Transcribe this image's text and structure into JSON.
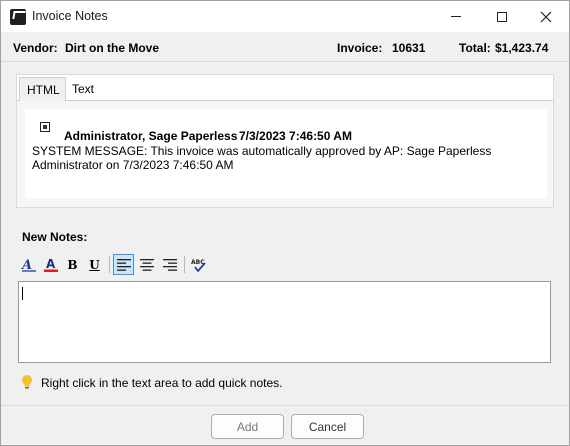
{
  "window": {
    "title": "Invoice Notes",
    "icon": "app-logo-icon"
  },
  "header": {
    "vendor_label": "Vendor:",
    "vendor_value": "Dirt on the Move",
    "invoice_label": "Invoice:",
    "invoice_value": "10631",
    "total_label": "Total:",
    "total_value": "$1,423.74"
  },
  "tabs": [
    {
      "label": "HTML",
      "selected": true
    },
    {
      "label": "Text",
      "selected": false
    }
  ],
  "notes": [
    {
      "author": "Administrator, Sage Paperless",
      "timestamp": "7/3/2023 7:46:50 AM",
      "body": "SYSTEM MESSAGE: This invoice was automatically approved by AP: Sage Paperless Administrator on 7/3/2023 7:46:50 AM"
    }
  ],
  "new_notes": {
    "label": "New Notes:",
    "toolbar": {
      "font_icon": "font-style-icon",
      "font_color_icon": "font-color-icon",
      "bold_label": "B",
      "underline_label": "U",
      "align_left_icon": "align-left-icon",
      "align_center_icon": "align-center-icon",
      "align_right_icon": "align-right-icon",
      "spellcheck_icon": "spellcheck-icon",
      "active_alignment": "left"
    },
    "editor_value": ""
  },
  "hint": {
    "icon": "lightbulb-icon",
    "text": "Right click in the text area to add quick notes."
  },
  "buttons": {
    "add_label": "Add",
    "add_enabled": false,
    "cancel_label": "Cancel"
  },
  "colors": {
    "window_bg": "#f0f0f0",
    "accent": "#4a90d9",
    "font_color_underline": "#e02020"
  }
}
